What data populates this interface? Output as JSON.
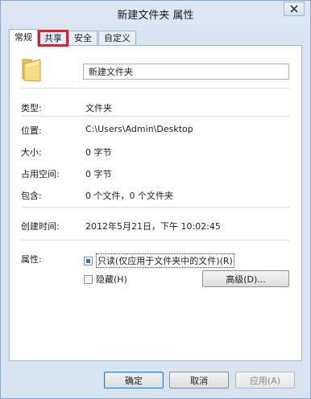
{
  "window": {
    "title": "新建文件夹 属性"
  },
  "tabs": [
    {
      "label": "常规",
      "active": true
    },
    {
      "label": "共享",
      "highlighted": true
    },
    {
      "label": "安全"
    },
    {
      "label": "自定义"
    }
  ],
  "general": {
    "folder_name": "新建文件夹",
    "type_label": "类型:",
    "type_value": "文件夹",
    "location_label": "位置:",
    "location_value": "C:\\Users\\Admin\\Desktop",
    "size_label": "大小:",
    "size_value": "0 字节",
    "disk_size_label": "占用空间:",
    "disk_size_value": "0 字节",
    "contains_label": "包含:",
    "contains_value": "0 个文件，0 个文件夹",
    "created_label": "创建时间:",
    "created_value": "2012年5月21日，下午 10:02:45",
    "attributes_label": "属性:",
    "readonly_label": "只读(仅应用于文件夹中的文件)(R)",
    "readonly_state": "indeterminate",
    "hidden_label": "隐藏(H)",
    "hidden_state": "unchecked",
    "advanced_button": "高级(D)..."
  },
  "footer": {
    "ok_button": "确定",
    "cancel_button": "取消",
    "apply_button": "应用(A)"
  },
  "colors": {
    "highlight_border": "#e0202a",
    "window_bg": "#d9e4f1"
  }
}
